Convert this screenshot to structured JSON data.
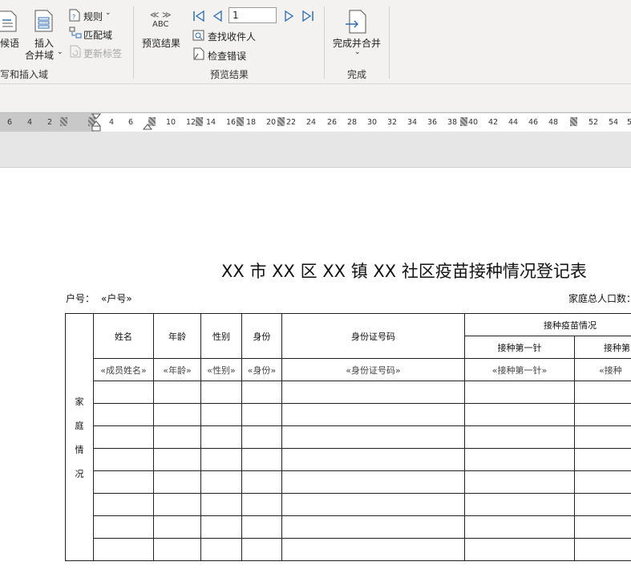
{
  "ribbon": {
    "write_insert_group": {
      "greeting_label": "候语",
      "insert_label_line1": "插入",
      "insert_label_line2": "合并域",
      "rules_label": "规则",
      "match_fields_label": "匹配域",
      "update_labels_label": "更新标签",
      "group_label": "写和插入域"
    },
    "preview_group": {
      "abc_icon_text": "ABC",
      "preview_results_label": "预览结果",
      "record_number": "1",
      "find_recipient_label": "查找收件人",
      "check_errors_label": "检查错误",
      "group_label": "预览结果"
    },
    "finish_group": {
      "finish_merge_label": "完成并合并",
      "group_label": "完成"
    }
  },
  "ruler": {
    "left_ticks": [
      "6",
      "4",
      "2"
    ],
    "right_ticks": [
      "4",
      "6",
      "10",
      "12",
      "14",
      "16",
      "18",
      "20",
      "22",
      "24",
      "26",
      "28",
      "30",
      "32",
      "34",
      "36",
      "38",
      "40",
      "42",
      "44",
      "46",
      "48",
      "52",
      "54",
      "5"
    ]
  },
  "document": {
    "title": "XX 市 XX 区 XX 镇 XX 社区疫苗接种情况登记表",
    "household_label": "户号：",
    "household_field": "«户号»",
    "total_population_label": "家庭总人口数：",
    "table": {
      "headers": {
        "name": "姓名",
        "age": "年龄",
        "gender": "性别",
        "identity": "身份",
        "id_number": "身份证号码",
        "vaccination": "接种疫苗情况",
        "first_dose": "接种第一针",
        "second_dose": "接种第"
      },
      "merge_row": {
        "name": "«成员姓名»",
        "age": "«年龄»",
        "gender": "«性别»",
        "identity": "«身份»",
        "id_number": "«身份证号码»",
        "first_dose": "«接种第一针»",
        "second_dose": "«接种"
      },
      "side_label": [
        "家",
        "庭",
        "情",
        "况"
      ]
    }
  }
}
